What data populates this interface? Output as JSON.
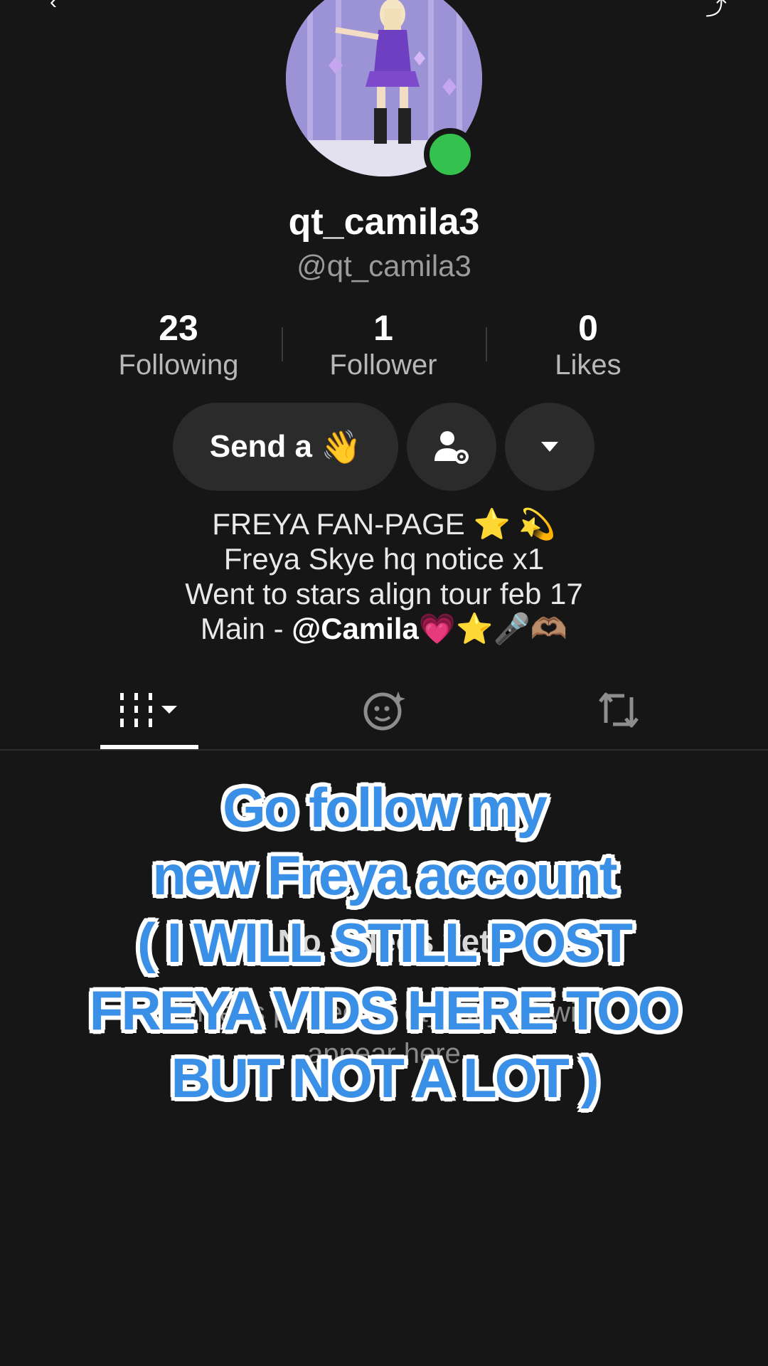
{
  "profile": {
    "display_name": "qt_camila3",
    "handle": "@qt_camila3"
  },
  "stats": {
    "following_count": "23",
    "following_label": "Following",
    "followers_count": "1",
    "followers_label": "Follower",
    "likes_count": "0",
    "likes_label": "Likes"
  },
  "actions": {
    "wave_label": "Send a",
    "wave_emoji": "👋"
  },
  "bio": {
    "line1": "FREYA FAN-PAGE ⭐️ 💫",
    "line2": "Freya Skye hq notice x1",
    "line3": "Went to stars align tour feb 17",
    "line4_prefix": "Main - ",
    "line4_mention": "@Camila",
    "line4_suffix": "💗⭐️🎤🫶🏽"
  },
  "empty_state": {
    "title": "No videos yet",
    "subtitle_line1": "Videos posted by qt_camila3 will",
    "subtitle_line2": "appear here"
  },
  "overlay": {
    "line1": "Go follow my",
    "line2": "new Freya account",
    "line3": "( I WILL STILL POST",
    "line4": "FREYA VIDS HERE TOO",
    "line5": "BUT NOT A LOT )"
  },
  "colors": {
    "background": "#161616",
    "online": "#35c14d",
    "overlay_text": "#3a8fe6"
  },
  "icons": [
    "back-arrow-icon",
    "share-icon",
    "person-settings-icon",
    "dropdown-caret-icon",
    "videos-grid-icon",
    "reposts-smile-icon",
    "repost-icon"
  ]
}
